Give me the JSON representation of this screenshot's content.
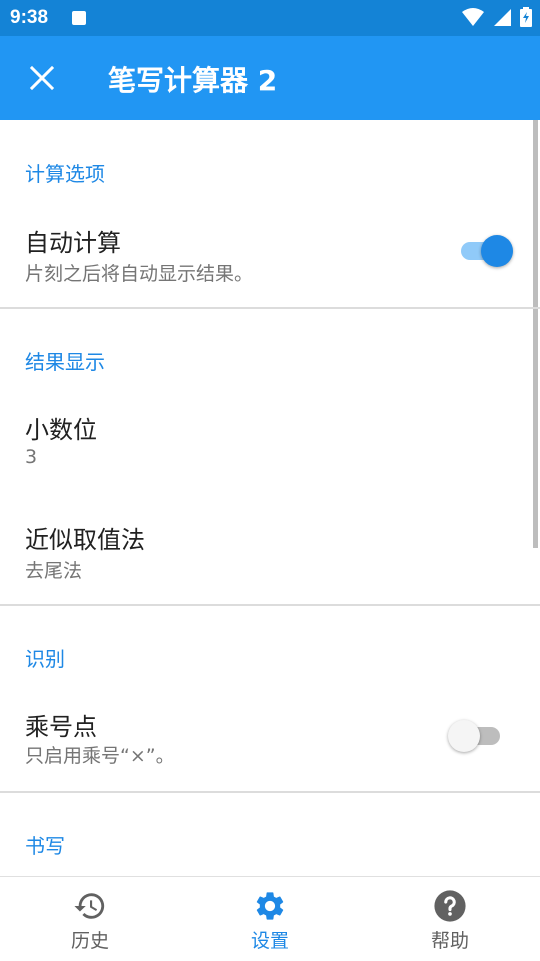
{
  "status_bar": {
    "time": "9:38"
  },
  "app_bar": {
    "title": "笔写计算器 2"
  },
  "settings": {
    "section_calc": "计算选项",
    "auto_calc": {
      "title": "自动计算",
      "summary": "片刻之后将自动显示结果。",
      "enabled": true
    },
    "section_result": "结果显示",
    "decimals": {
      "title": "小数位",
      "value": "3"
    },
    "rounding": {
      "title": "近似取值法",
      "value": "去尾法"
    },
    "section_recognition": "识别",
    "mult_dot": {
      "title": "乘号点",
      "summary": "只启用乘号“×”。",
      "enabled": false
    },
    "section_writing": "书写"
  },
  "bottom_nav": {
    "history": "历史",
    "settings": "设置",
    "help": "帮助"
  },
  "colors": {
    "primary": "#2196f3",
    "status_bar": "#1483d6",
    "accent": "#1e88e5",
    "inactive": "#757575"
  }
}
